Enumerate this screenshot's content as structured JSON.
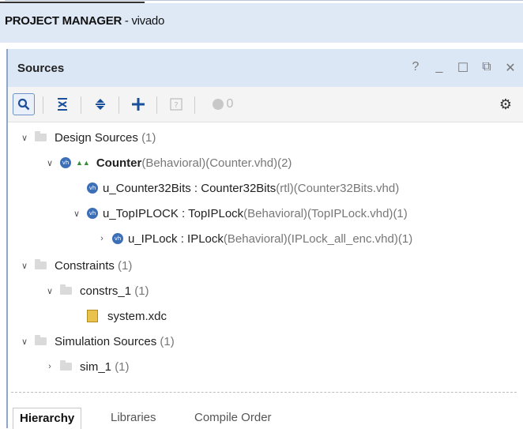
{
  "title_bar": {
    "bold": "PROJECT MANAGER",
    "rest": " - vivado"
  },
  "panel": {
    "title": "Sources",
    "header_icons": [
      "help-icon",
      "minimize-icon",
      "maximize-icon",
      "float-icon",
      "close-icon"
    ],
    "header_glyphs": {
      "help": "?",
      "min": "_",
      "max": "☐",
      "float": "⧉",
      "close": "✕"
    }
  },
  "toolbar": {
    "search": "🔍",
    "collapse": "≚",
    "expand": "≙",
    "add": "+",
    "help": "?",
    "counter": "0",
    "gear": "⚙"
  },
  "tree": {
    "design_sources": {
      "label": "Design Sources",
      "count": "(1)"
    },
    "counter": {
      "name": "Counter",
      "arch": "(Behavioral)",
      "file": " (Counter.vhd)",
      "count": " (2)"
    },
    "counter32": {
      "name": "u_Counter32Bits : Counter32Bits",
      "arch": "(rtl)",
      "file": " (Counter32Bits.vhd)"
    },
    "topiplock": {
      "name": "u_TopIPLOCK : TopIPLock",
      "arch": "(Behavioral)",
      "file": " (TopIPLock.vhd)",
      "count": " (1)"
    },
    "iplock": {
      "name": "u_IPLock : IPLock",
      "arch": "(Behavioral)",
      "file": " (IPLock_all_enc.vhd)",
      "count": " (1)"
    },
    "constraints": {
      "label": "Constraints",
      "count": "(1)"
    },
    "constrs_1": {
      "label": "constrs_1",
      "count": "(1)"
    },
    "system_xdc": {
      "label": "system.xdc"
    },
    "simulation": {
      "label": "Simulation Sources",
      "count": "(1)"
    },
    "sim_1": {
      "label": "sim_1",
      "count": "(1)"
    },
    "vh_badge": "vh"
  },
  "tabs": [
    "Hierarchy",
    "Libraries",
    "Compile Order"
  ]
}
